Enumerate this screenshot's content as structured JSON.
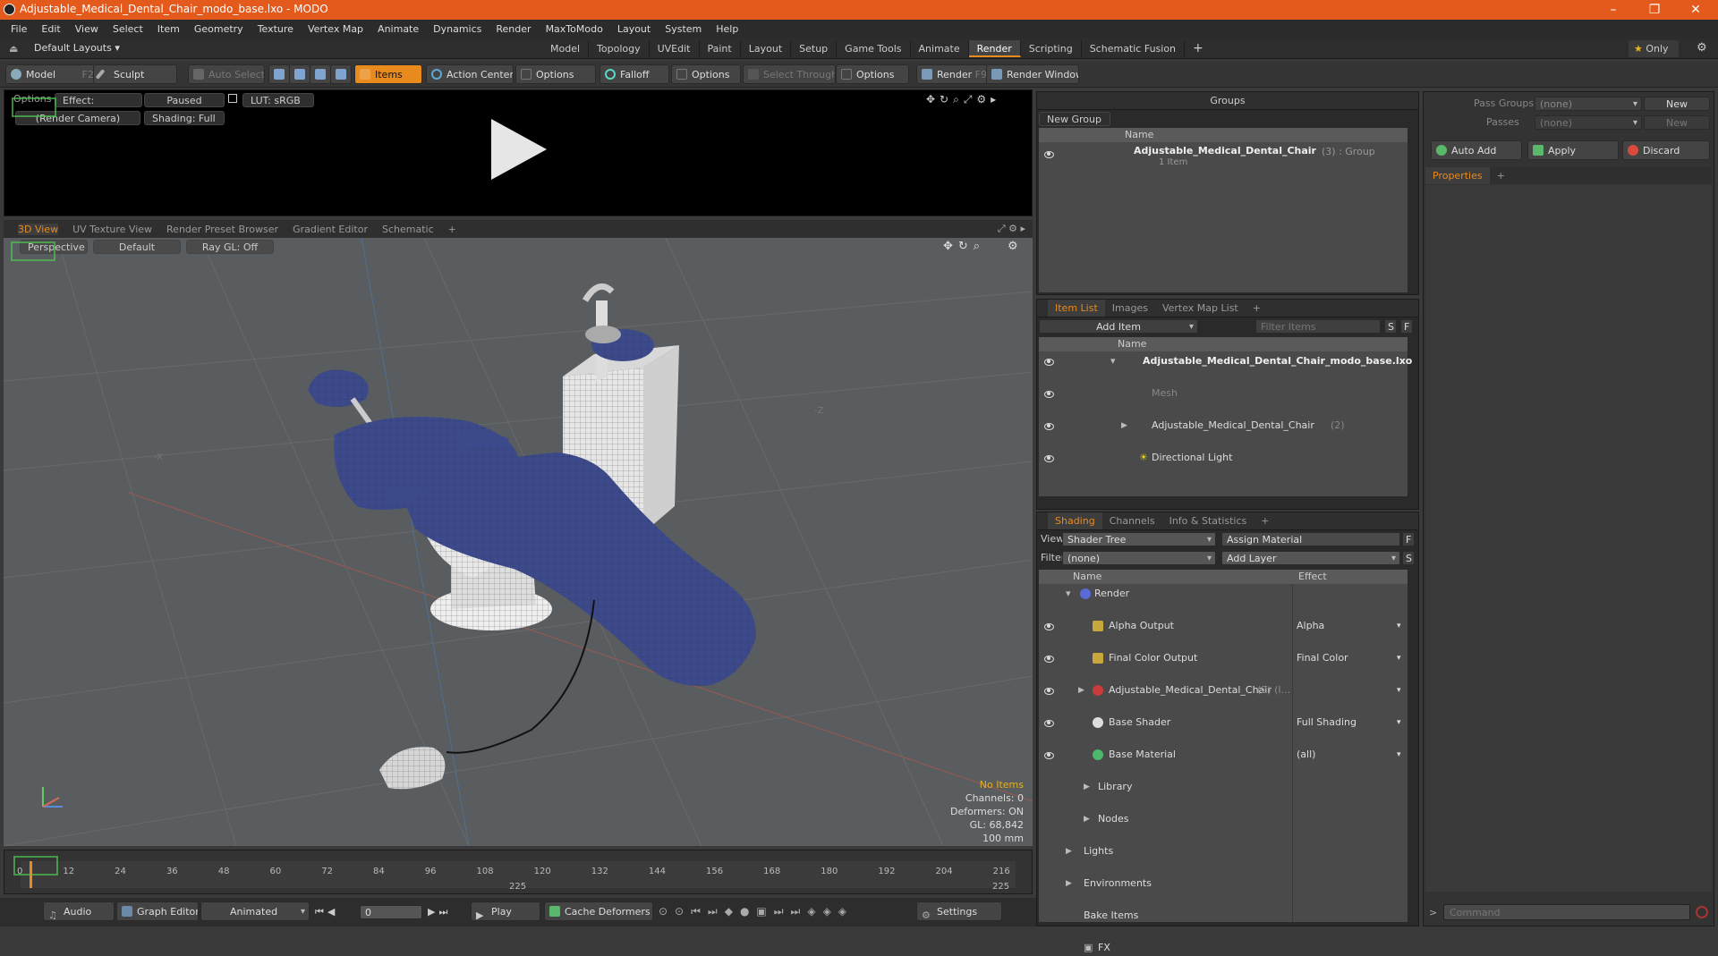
{
  "window": {
    "title": "Adjustable_Medical_Dental_Chair_modo_base.lxo - MODO"
  },
  "menu": [
    "File",
    "Edit",
    "View",
    "Select",
    "Item",
    "Geometry",
    "Texture",
    "Vertex Map",
    "Animate",
    "Dynamics",
    "Render",
    "MaxToModo",
    "Layout",
    "System",
    "Help"
  ],
  "layouts": {
    "dropdown": "Default Layouts",
    "tabs": [
      "Model",
      "Topology",
      "UVEdit",
      "Paint",
      "Layout",
      "Setup",
      "Game Tools",
      "Animate",
      "Render",
      "Scripting",
      "Schematic Fusion"
    ],
    "active": "Render",
    "add": "+",
    "only": "Only"
  },
  "toolbar": {
    "model": "Model",
    "model_key": "F2",
    "sculpt": "Sculpt",
    "auto_select": "Auto Select",
    "items": "Items",
    "action_center": "Action Center",
    "options1": "Options",
    "falloff": "Falloff",
    "options2": "Options",
    "select_through": "Select Through",
    "options3": "Options",
    "render": "Render",
    "render_key": "F9",
    "render_window": "Render Window"
  },
  "preview": {
    "effect": "Effect: (Shadi...",
    "paused": "Paused",
    "lut": "LUT: sRGB",
    "camera": "(Render Camera)",
    "shading": "Shading: Full",
    "overlay_left": "Options"
  },
  "viewport_tabs": {
    "tabs": [
      "3D View",
      "UV Texture View",
      "Render Preset Browser",
      "Gradient Editor",
      "Schematic"
    ],
    "active": "3D View",
    "add": "+"
  },
  "viewport": {
    "perspective": "Perspective",
    "default": "Default",
    "raygl": "Ray GL: Off",
    "axis_x": "-X",
    "axis_z": "-Z",
    "stats": {
      "no_items": "No Items",
      "channels": "Channels: 0",
      "deformers": "Deformers: ON",
      "gl": "GL: 68,842",
      "size": "100 mm"
    }
  },
  "timeline": {
    "ticks": [
      "0",
      "12",
      "24",
      "36",
      "48",
      "60",
      "72",
      "84",
      "96",
      "108",
      "120",
      "132",
      "144",
      "156",
      "168",
      "180",
      "192",
      "204",
      "216"
    ],
    "marker_mid": "225",
    "marker_end": "225"
  },
  "transport": {
    "audio": "Audio",
    "graph_editor": "Graph Editor",
    "animated": "Animated",
    "frame": "0",
    "play": "Play",
    "cache": "Cache Deformers",
    "settings": "Settings"
  },
  "groups": {
    "title": "Groups",
    "new_group": "New Group",
    "col_name": "Name",
    "item_name": "Adjustable_Medical_Dental_Chair",
    "item_meta": "(3) : Group",
    "item_sub": "1 Item"
  },
  "passes": {
    "pass_groups_label": "Pass Groups",
    "pass_groups_value": "(none)",
    "passes_label": "Passes",
    "passes_value": "(none)",
    "new": "New",
    "new2": "New",
    "auto_add": "Auto Add",
    "apply": "Apply",
    "discard": "Discard",
    "properties": "Properties",
    "add": "+"
  },
  "itemlist": {
    "tabs": [
      "Item List",
      "Images",
      "Vertex Map List"
    ],
    "active": "Item List",
    "add": "+",
    "add_item": "Add Item",
    "filter": "Filter Items",
    "s": "S",
    "f": "F",
    "col_name": "Name",
    "rows": [
      {
        "label": "Adjustable_Medical_Dental_Chair_modo_base.lxo",
        "extra": ""
      },
      {
        "label": "Mesh",
        "extra": ""
      },
      {
        "label": "Adjustable_Medical_Dental_Chair",
        "extra": "(2)"
      },
      {
        "label": "Directional Light",
        "extra": ""
      }
    ]
  },
  "shading": {
    "tabs": [
      "Shading",
      "Channels",
      "Info & Statistics"
    ],
    "active": "Shading",
    "add": "+",
    "view_label": "View",
    "view_value": "Shader Tree",
    "assign": "Assign Material",
    "f": "F",
    "filter_label": "Filter",
    "filter_value": "(none)",
    "add_layer": "Add Layer",
    "s": "S",
    "col_name": "Name",
    "col_effect": "Effect",
    "rows": [
      {
        "label": "Render",
        "effect": ""
      },
      {
        "label": "Alpha Output",
        "effect": "Alpha"
      },
      {
        "label": "Final Color Output",
        "effect": "Final Color"
      },
      {
        "label": "Adjustable_Medical_Dental_Chair",
        "extra": "(2) (I...",
        "effect": ""
      },
      {
        "label": "Base Shader",
        "effect": "Full Shading"
      },
      {
        "label": "Base Material",
        "effect": "(all)"
      },
      {
        "label": "Library",
        "effect": ""
      },
      {
        "label": "Nodes",
        "effect": ""
      },
      {
        "label": "Lights",
        "effect": ""
      },
      {
        "label": "Environments",
        "effect": ""
      },
      {
        "label": "Bake Items",
        "effect": ""
      },
      {
        "label": "FX",
        "effect": ""
      }
    ]
  },
  "command": {
    "placeholder": "Command",
    "prompt": ">"
  }
}
